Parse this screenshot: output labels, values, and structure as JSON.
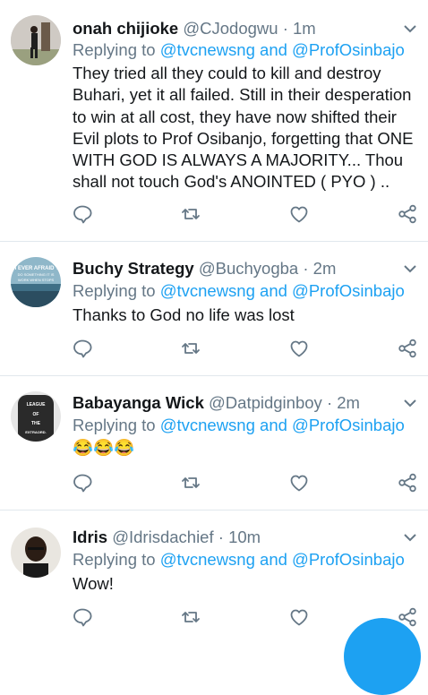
{
  "colors": {
    "accent": "#1da1f2",
    "muted": "#657786",
    "text": "#14171a",
    "divider": "#e1e8ed"
  },
  "tweets": [
    {
      "name": "onah chijioke",
      "handle": "@CJodogwu",
      "sep": "·",
      "time": "1m",
      "reply_prefix": "Replying to",
      "reply_to": "@tvcnewsng and @ProfOsinbajo",
      "body": "They tried all they could to kill and destroy Buhari, yet it all failed. Still in their desperation to win at all cost, they have now shifted their Evil plots to Prof Osibanjo, forgetting that ONE WITH GOD IS ALWAYS A MAJORITY... Thou shall not touch God's ANOINTED ( PYO ) .."
    },
    {
      "name": "Buchy Strategy",
      "handle": "@Buchyogba",
      "sep": "·",
      "time": "2m",
      "reply_prefix": "Replying to",
      "reply_to": "@tvcnewsng and @ProfOsinbajo",
      "body": "Thanks to God no life was lost",
      "avatar_text": "IF I EVER AFRAID TO DO SOMETHING IT IS WORK WHEN STOPS THE PROUD AND"
    },
    {
      "name": "Babayanga Wick",
      "handle": "@Datpidginboy",
      "sep": "·",
      "time": "2m",
      "reply_prefix": "Replying to",
      "reply_to": "@tvcnewsng and @ProfOsinbajo",
      "body": "😂😂😂",
      "avatar_text": "LEAGUE OF THE EXTRAORDINARY"
    },
    {
      "name": "Idris",
      "handle": "@Idrisdachief",
      "sep": "·",
      "time": "10m",
      "reply_prefix": "Replying to",
      "reply_to": "@tvcnewsng and @ProfOsinbajo",
      "body": "Wow!"
    }
  ],
  "icons": {
    "reply": "reply-icon",
    "retweet": "retweet-icon",
    "like": "heart-icon",
    "share": "share-icon",
    "more": "chevron-down-icon",
    "compose": "compose-fab"
  }
}
